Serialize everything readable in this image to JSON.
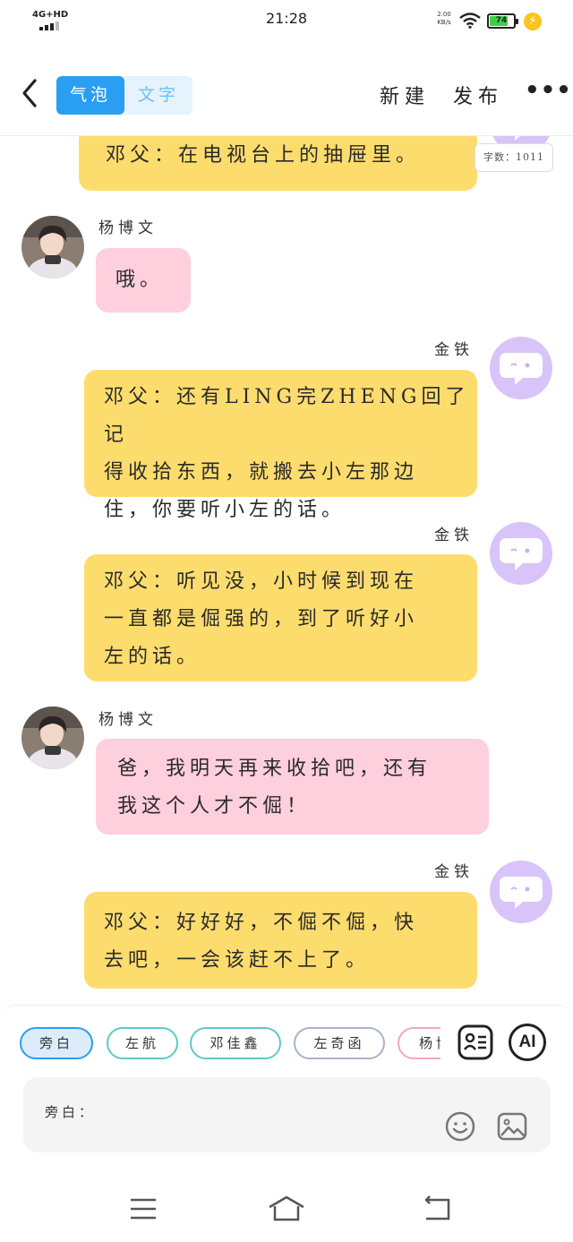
{
  "status_bar": {
    "network": "4G+HD",
    "time": "21:28",
    "speed_value": "2.00",
    "speed_unit": "KB/s",
    "battery": "74"
  },
  "header": {
    "tab_bubble": "气泡",
    "tab_text": "文字",
    "new_label": "新建",
    "publish_label": "发布",
    "more_label": "•••"
  },
  "chat": {
    "word_count": "字数：1011",
    "messages": [
      {
        "speaker": "",
        "side": "right",
        "color": "yellow",
        "lines": [
          "邓父：在电视台上的抽屉里。"
        ]
      },
      {
        "speaker": "杨博文",
        "side": "left",
        "color": "pink",
        "lines": [
          "哦。"
        ]
      },
      {
        "speaker": "金铁",
        "side": "right",
        "color": "yellow",
        "lines": [
          "邓父：还有LING完ZHENG回了记",
          "得收拾东西，就搬去小左那边",
          "住，你要听小左的话。"
        ]
      },
      {
        "speaker": "金铁",
        "side": "right",
        "color": "yellow",
        "lines": [
          "邓父：听见没，小时候到现在",
          "一直都是倔强的，到了听好小",
          "左的话。"
        ]
      },
      {
        "speaker": "杨博文",
        "side": "left",
        "color": "pink",
        "lines": [
          "爸，我明天再来收拾吧，还有",
          "我这个人才不倔！"
        ]
      },
      {
        "speaker": "金铁",
        "side": "right",
        "color": "yellow",
        "lines": [
          "邓父：好好好，不倔不倔，快",
          "去吧，一会该赶不上了。"
        ]
      }
    ]
  },
  "bottom": {
    "chips": [
      "旁白",
      "左航",
      "邓佳鑫",
      "左奇函",
      "杨博文"
    ],
    "ai_label": "AI",
    "input_label": "旁白："
  },
  "colors": {
    "accent": "#2a9ef0",
    "yellow_bubble": "#fddc6e",
    "pink_bubble": "#fecfdc",
    "bot_avatar": "#d8c4f8"
  }
}
